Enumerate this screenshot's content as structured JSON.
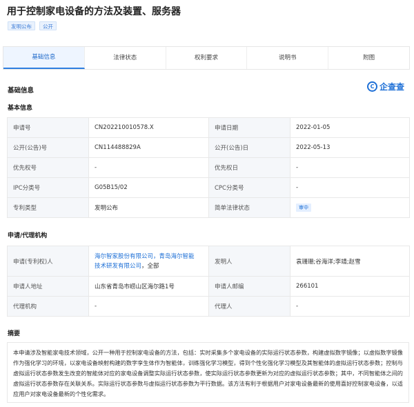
{
  "page": {
    "title": "用于控制家电设备的方法及装置、服务器"
  },
  "tags": [
    "发明公布",
    "公开"
  ],
  "tabs": [
    "基础信息",
    "法律状态",
    "权利要求",
    "说明书",
    "附图"
  ],
  "section": {
    "title": "基础信息",
    "logo_text": "企查查"
  },
  "basic": {
    "heading": "基本信息",
    "rows": [
      [
        "申请号",
        "CN202210010578.X",
        "申请日期",
        "2022-01-05"
      ],
      [
        "公开(公告)号",
        "CN114488829A",
        "公开(公告)日",
        "2022-05-13"
      ],
      [
        "优先权号",
        "-",
        "优先权日",
        "-"
      ],
      [
        "IPC分类号",
        "G05B15/02",
        "CPC分类号",
        "-"
      ],
      [
        "专利类型",
        "发明公布",
        "简单法律状态",
        "审中"
      ]
    ]
  },
  "agency": {
    "heading": "申请/代理机构",
    "applicant_label": "申请(专利权)人",
    "applicant_line1": "海尔智家股份有限公司，青岛海尔智能",
    "applicant_line2_link": "技术研发有限公司",
    "applicant_line2_rest": "，全部",
    "inventor_label": "发明人",
    "inventor_value": "袁珊珊;谷海洋;李靖;赵雪",
    "address_label": "申请人地址",
    "address_value": "山东省青岛市崂山区海尔路1号",
    "postcode_label": "申请人邮编",
    "postcode_value": "266101",
    "agency_label": "代理机构",
    "agency_value": "-",
    "agent_label": "代理人",
    "agent_value": "-"
  },
  "abstract": {
    "heading": "摘要",
    "text": "本申请涉及智能家电技术领域，公开一种用于控制家电设备的方法，包括：实时采集多个家电设备的实际运行状态参数，构建虚拟数字镜像；以虚拟数字镜像作为强化学习的环境，以家电设备映射构建的数字孪生体作为智能体，训练强化学习模型，得到个性化强化学习模型及其智能体的虚拟运行状态参数；控制与虚拟运行状态参数发生改变的智能体对应的家电设备调整实际运行状态参数，使实际运行状态参数更新为对应的虚拟运行状态参数；其中，不同智能体之间的虚拟运行状态参数存在关联关系。实际运行状态参数与虚拟运行状态参数为平行数据。该方法有利于根据用户对家电设备最新的使用喜好控制家电设备，以适应用户对家电设备最新的个性化需求。"
  }
}
